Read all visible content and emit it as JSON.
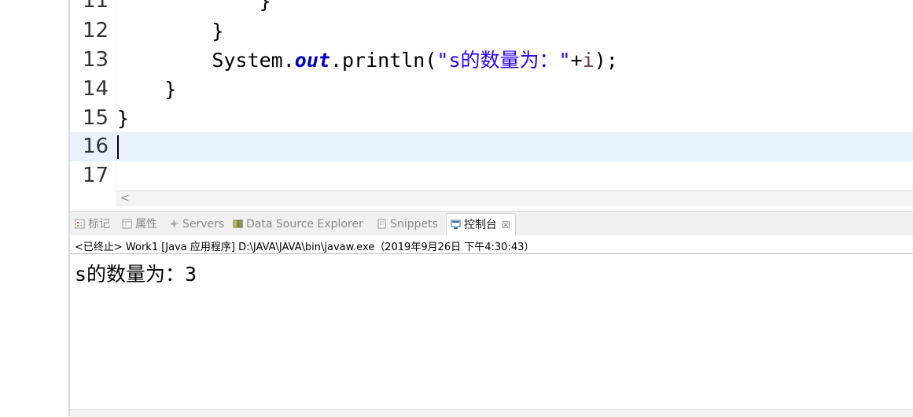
{
  "editor": {
    "lines": [
      {
        "num": "11",
        "code": "            }"
      },
      {
        "num": "12",
        "code": "        }"
      },
      {
        "num": "13",
        "pre": "        System.",
        "field": "out",
        "mid": ".println(",
        "str": "\"s的数量为：\"",
        "plus": "+",
        "var": "i",
        "post": ");"
      },
      {
        "num": "14",
        "code": "    }"
      },
      {
        "num": "15",
        "code": "}"
      },
      {
        "num": "16",
        "code": ""
      },
      {
        "num": "17",
        "code": ""
      }
    ],
    "scroll_left_arrow": "<"
  },
  "tabs": {
    "markers": "标记",
    "properties": "属性",
    "servers": "Servers",
    "data_source_explorer": "Data Source Explorer",
    "snippets": "Snippets",
    "console": "控制台",
    "console_close": "☒"
  },
  "console": {
    "header": "<已终止> Work1 [Java 应用程序] D:\\JAVA\\JAVA\\bin\\javaw.exe（2019年9月26日 下午4:30:43）",
    "output": "s的数量为：3"
  },
  "colors": {
    "current_line": "#e8f2fe",
    "string": "#2a00ff",
    "field": "#0000c0"
  }
}
